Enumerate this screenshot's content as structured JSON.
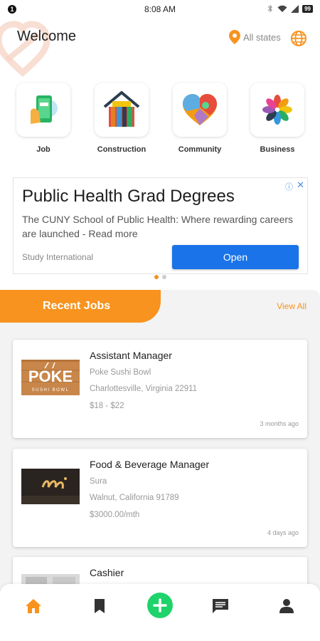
{
  "status_bar": {
    "notification_count": "1",
    "time": "8:08 AM",
    "battery": "99"
  },
  "header": {
    "title": "Welcome",
    "location_label": "All states"
  },
  "categories": [
    {
      "label": "Job",
      "icon": "job-icon"
    },
    {
      "label": "Construction",
      "icon": "construction-icon"
    },
    {
      "label": "Community",
      "icon": "community-icon"
    },
    {
      "label": "Business",
      "icon": "business-icon"
    }
  ],
  "ad": {
    "headline": "Public Health Grad Degrees",
    "body": "The CUNY School of Public Health: Where rewarding careers are launched - Read more",
    "advertiser": "Study International",
    "cta": "Open"
  },
  "recent_jobs": {
    "title": "Recent Jobs",
    "view_all": "View All",
    "items": [
      {
        "title": "Assistant Manager",
        "company": "Poke Sushi Bowl",
        "location": "Charlottesville, Virginia 22911",
        "pay": "$18 - $22",
        "posted": "3 months ago",
        "logo_text": "POKE",
        "logo_sub": "SUSHI BOWL"
      },
      {
        "title": "Food & Beverage Manager",
        "company": "Sura",
        "location": "Walnut, California 91789",
        "pay": "$3000.00/mth",
        "posted": "4 days ago"
      },
      {
        "title": "Cashier"
      }
    ]
  },
  "bottom_nav": [
    "home-icon",
    "bookmark-icon",
    "add-icon",
    "chat-icon",
    "profile-icon"
  ],
  "colors": {
    "accent": "#f7931e",
    "add_button": "#1fd36b",
    "ad_button": "#1a73e8"
  }
}
